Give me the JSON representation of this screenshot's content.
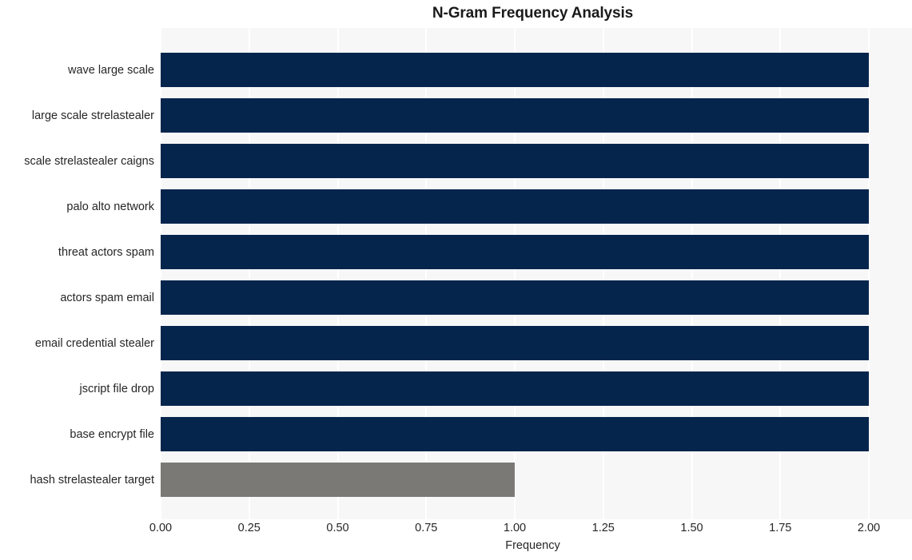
{
  "chart_data": {
    "type": "bar",
    "orientation": "horizontal",
    "title": "N-Gram Frequency Analysis",
    "xlabel": "Frequency",
    "ylabel": "",
    "categories": [
      "wave large scale",
      "large scale strelastealer",
      "scale strelastealer caigns",
      "palo alto network",
      "threat actors spam",
      "actors spam email",
      "email credential stealer",
      "jscript file drop",
      "base encrypt file",
      "hash strelastealer target"
    ],
    "values": [
      2,
      2,
      2,
      2,
      2,
      2,
      2,
      2,
      2,
      1
    ],
    "bar_colors": [
      "#06254d",
      "#06254d",
      "#06254d",
      "#06254d",
      "#06254d",
      "#06254d",
      "#06254d",
      "#06254d",
      "#06254d",
      "#7b7976"
    ],
    "xlim": [
      0,
      2
    ],
    "xticks": [
      0,
      0.25,
      0.5,
      0.75,
      1,
      1.25,
      1.5,
      1.75,
      2
    ],
    "xtick_labels": [
      "0.00",
      "0.25",
      "0.50",
      "0.75",
      "1.00",
      "1.25",
      "1.50",
      "1.75",
      "2.00"
    ],
    "grid": true,
    "grid_axis": "x",
    "legend": null,
    "plot_background": "#f7f7f8",
    "figure_background": "#ffffff",
    "gridline_color": "#ffffff",
    "text_color": "#262626"
  }
}
